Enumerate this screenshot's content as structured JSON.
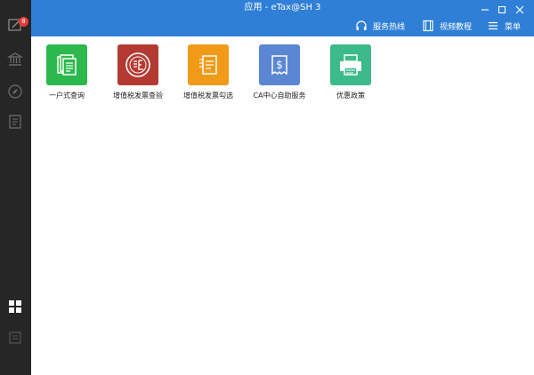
{
  "window": {
    "title": "应用 - eTax@SH 3"
  },
  "toolbar": {
    "hotline_label": "服务热线",
    "tutorial_label": "视频教程",
    "menu_label": "菜单"
  },
  "sidebar": {
    "badge_count": "8",
    "items": [
      {
        "icon": "edit-icon"
      },
      {
        "icon": "bank-icon"
      },
      {
        "icon": "compass-icon"
      },
      {
        "icon": "invoice-icon"
      },
      {
        "icon": "apps-grid-icon"
      },
      {
        "icon": "list-icon"
      }
    ]
  },
  "apps": [
    {
      "label": "一户式查询",
      "color": "#2db84d",
      "icon": "documents-icon"
    },
    {
      "label": "增值税发票查验",
      "color": "#b33a32",
      "icon": "certificate-seal-icon"
    },
    {
      "label": "增值税发票勾选",
      "color": "#f09a17",
      "icon": "document-check-icon"
    },
    {
      "label": "CA中心自助服务",
      "color": "#5b86d2",
      "icon": "receipt-dollar-icon"
    },
    {
      "label": "优惠政策",
      "color": "#3dba8c",
      "icon": "printer-icon"
    }
  ]
}
